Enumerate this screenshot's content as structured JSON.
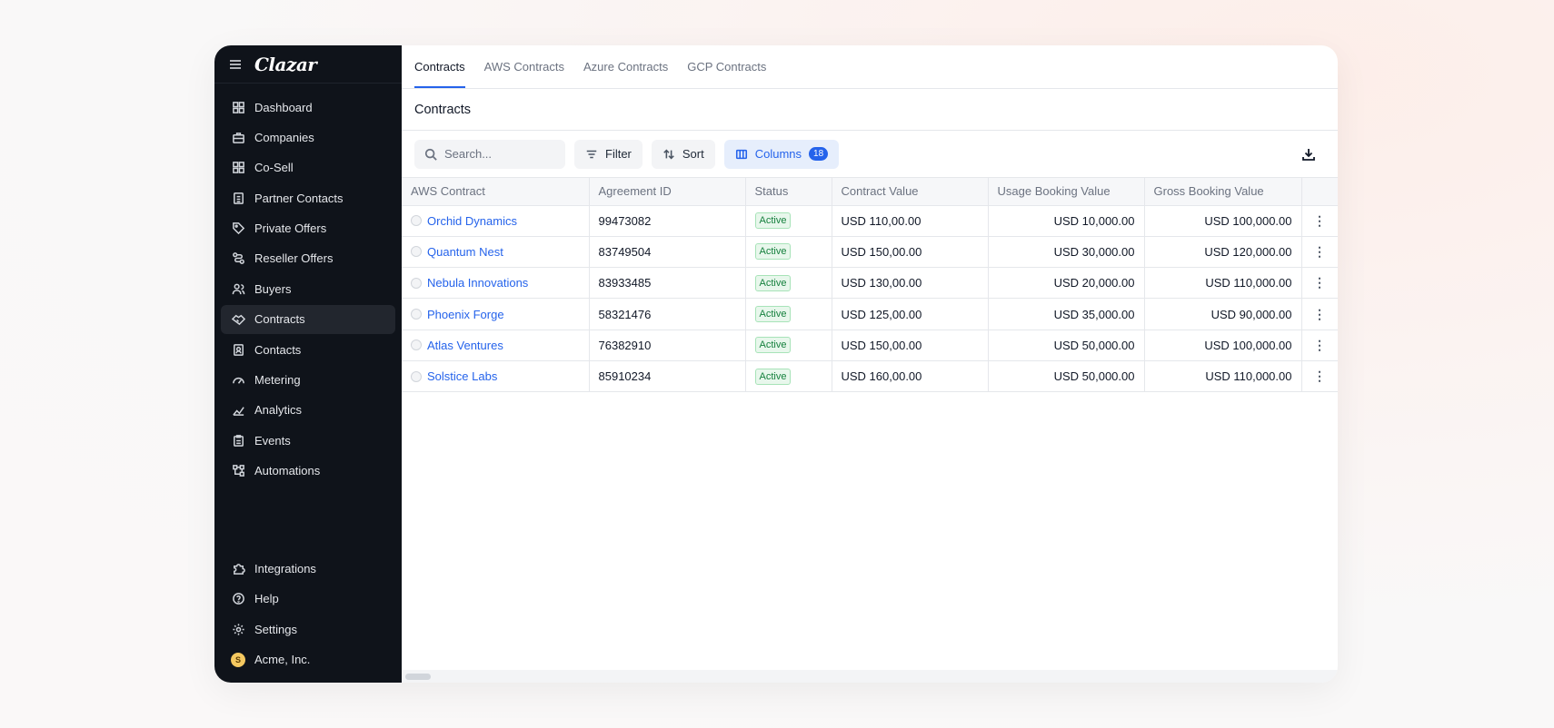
{
  "app": {
    "logo": "Clazar"
  },
  "sidebar": {
    "items": [
      {
        "label": "Dashboard",
        "icon": "dashboard-icon"
      },
      {
        "label": "Companies",
        "icon": "briefcase-icon"
      },
      {
        "label": "Co-Sell",
        "icon": "grid-icon"
      },
      {
        "label": "Partner Contacts",
        "icon": "badge-icon"
      },
      {
        "label": "Private Offers",
        "icon": "tag-icon"
      },
      {
        "label": "Reseller Offers",
        "icon": "route-icon"
      },
      {
        "label": "Buyers",
        "icon": "users-icon"
      },
      {
        "label": "Contracts",
        "icon": "handshake-icon",
        "active": true
      },
      {
        "label": "Contacts",
        "icon": "contact-icon"
      },
      {
        "label": "Metering",
        "icon": "gauge-icon"
      },
      {
        "label": "Analytics",
        "icon": "chart-icon"
      },
      {
        "label": "Events",
        "icon": "clipboard-icon"
      },
      {
        "label": "Automations",
        "icon": "workflow-icon"
      }
    ],
    "bottom": [
      {
        "label": "Integrations",
        "icon": "puzzle-icon"
      },
      {
        "label": "Help",
        "icon": "help-icon"
      },
      {
        "label": "Settings",
        "icon": "gear-icon"
      },
      {
        "label": "Acme, Inc.",
        "icon": "avatar",
        "avatar_letter": "S"
      }
    ]
  },
  "tabs": [
    "Contracts",
    "AWS Contracts",
    "Azure Contracts",
    "GCP Contracts"
  ],
  "page_title": "Contracts",
  "toolbar": {
    "search_placeholder": "Search...",
    "filter_label": "Filter",
    "sort_label": "Sort",
    "columns_label": "Columns",
    "columns_count": "18"
  },
  "table": {
    "headers": [
      "AWS Contract",
      "Agreement ID",
      "Status",
      "Contract Value",
      "Usage Booking Value",
      "Gross Booking Value"
    ],
    "rows": [
      [
        "Orchid Dynamics",
        "99473082",
        "Active",
        "USD 110,00.00",
        "USD 10,000.00",
        "USD 100,000.00"
      ],
      [
        "Quantum Nest",
        "83749504",
        "Active",
        "USD 150,00.00",
        "USD 30,000.00",
        "USD 120,000.00"
      ],
      [
        "Nebula Innovations",
        "83933485",
        "Active",
        "USD 130,00.00",
        "USD 20,000.00",
        "USD 110,000.00"
      ],
      [
        "Phoenix Forge",
        "58321476",
        "Active",
        "USD 125,00.00",
        "USD 35,000.00",
        "USD 90,000.00"
      ],
      [
        "Atlas Ventures",
        "76382910",
        "Active",
        "USD 150,00.00",
        "USD 50,000.00",
        "USD 100,000.00"
      ],
      [
        "Solstice Labs",
        "85910234",
        "Active",
        "USD 160,00.00",
        "USD 50,000.00",
        "USD 110,000.00"
      ]
    ]
  },
  "colors": {
    "accent": "#2563eb",
    "sidebar_bg": "#0f131a",
    "status_green": "#15803d"
  }
}
